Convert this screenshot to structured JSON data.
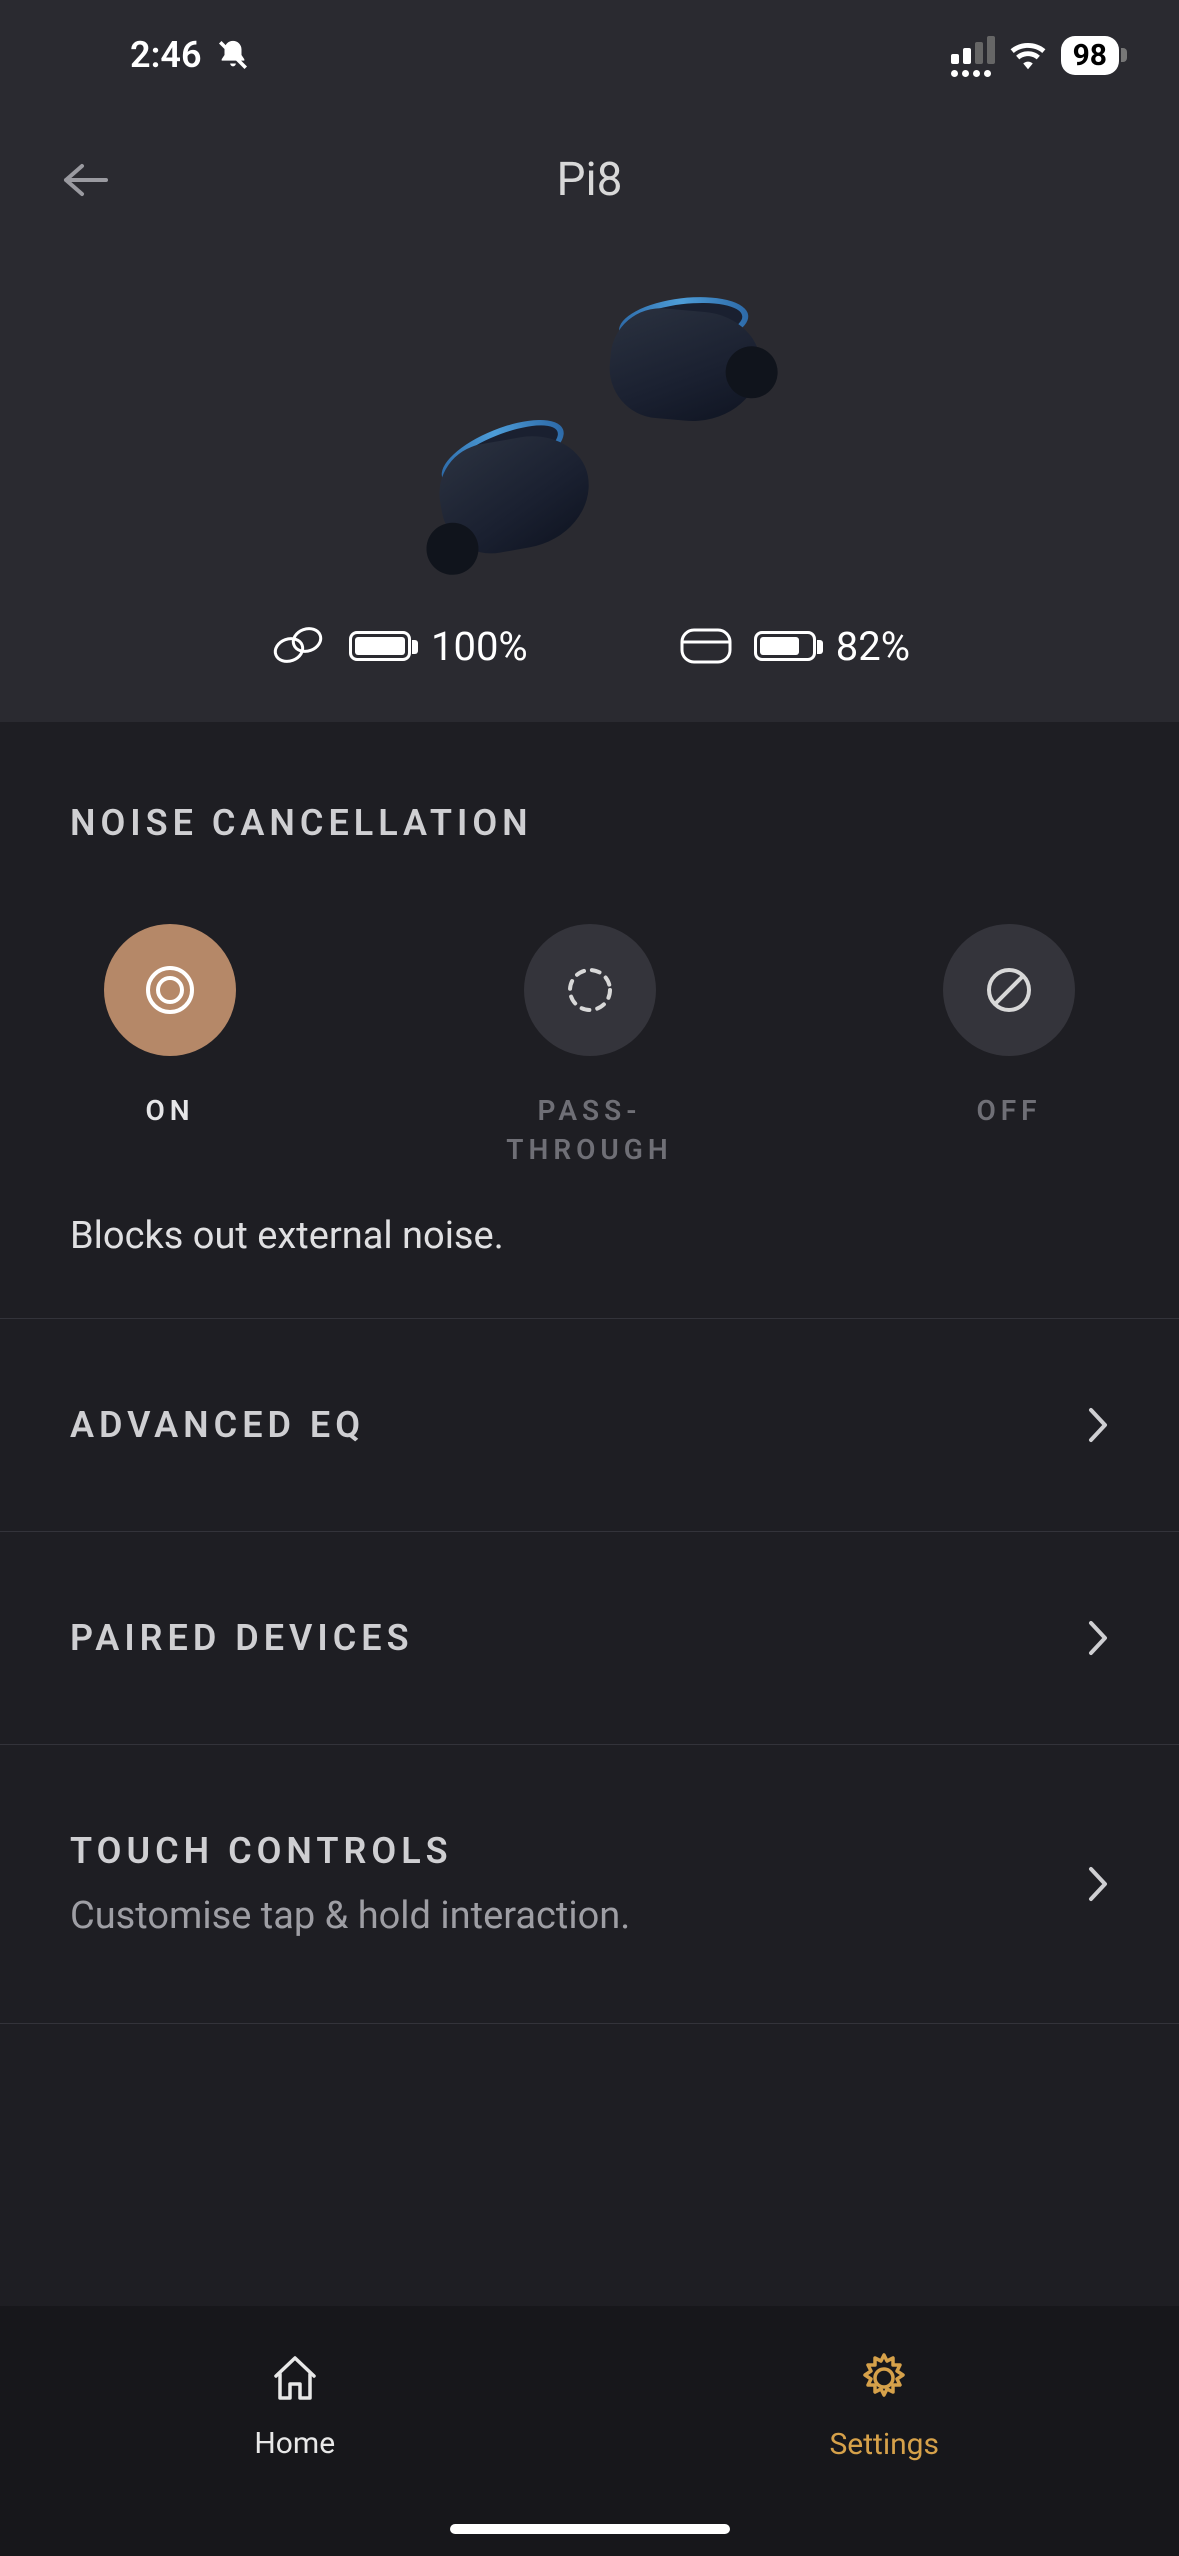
{
  "status": {
    "time": "2:46",
    "battery_percent": "98"
  },
  "header": {
    "title": "Pi8"
  },
  "product": {
    "buds_battery": "100%",
    "case_battery": "82%"
  },
  "anc": {
    "title": "NOISE CANCELLATION",
    "modes": {
      "on": "ON",
      "passthrough": "PASS-THROUGH",
      "off": "OFF"
    },
    "selected": "on",
    "description": "Blocks out external noise."
  },
  "menu": {
    "advanced_eq": {
      "title": "ADVANCED EQ"
    },
    "paired_devices": {
      "title": "PAIRED DEVICES"
    },
    "touch_controls": {
      "title": "TOUCH CONTROLS",
      "subtitle": "Customise tap & hold interaction."
    }
  },
  "tabs": {
    "home": "Home",
    "settings": "Settings"
  }
}
